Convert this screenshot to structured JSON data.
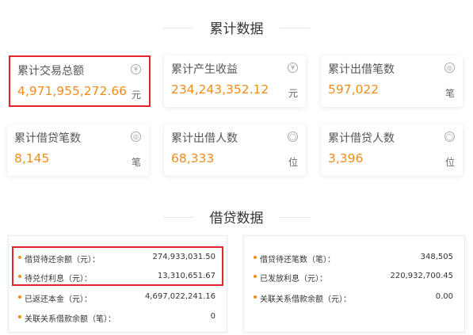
{
  "sections": {
    "cumulative_title": "累计数据",
    "loan_title": "借贷数据"
  },
  "cards": [
    {
      "label": "累计交易总额",
      "value": "4,971,955,272.66",
      "icon": "¥",
      "unit": "元"
    },
    {
      "label": "累计产生收益",
      "value": "234,243,352.12",
      "icon": "¥",
      "unit": "元"
    },
    {
      "label": "累计出借笔数",
      "value": "597,022",
      "icon": "◎",
      "unit": "笔"
    },
    {
      "label": "累计借贷笔数",
      "value": "8,145",
      "icon": "◎",
      "unit": "笔"
    },
    {
      "label": "累计出借人数",
      "value": "68,333",
      "icon": "◯",
      "unit": "位"
    },
    {
      "label": "累计借贷人数",
      "value": "3,396",
      "icon": "◯",
      "unit": "位"
    }
  ],
  "left_panel": [
    {
      "label": "借贷待还余额（元）：",
      "value": "274,933,031.50"
    },
    {
      "label": "待兑付利息（元）：",
      "value": "13,310,651.67"
    },
    {
      "label": "已返还本金（元）：",
      "value": "4,697,022,241.16"
    },
    {
      "label": "关联关系借款余额（笔）：",
      "value": "0"
    }
  ],
  "right_panel": [
    {
      "label": "借贷待还笔数（笔）：",
      "value": "348,505"
    },
    {
      "label": "已发放利息（元）：",
      "value": "220,932,700.45"
    },
    {
      "label": "关联关系借款余额（元）：",
      "value": "0.00"
    }
  ],
  "colors": {
    "accent": "#f28c1a",
    "highlight": "#e5242b"
  }
}
